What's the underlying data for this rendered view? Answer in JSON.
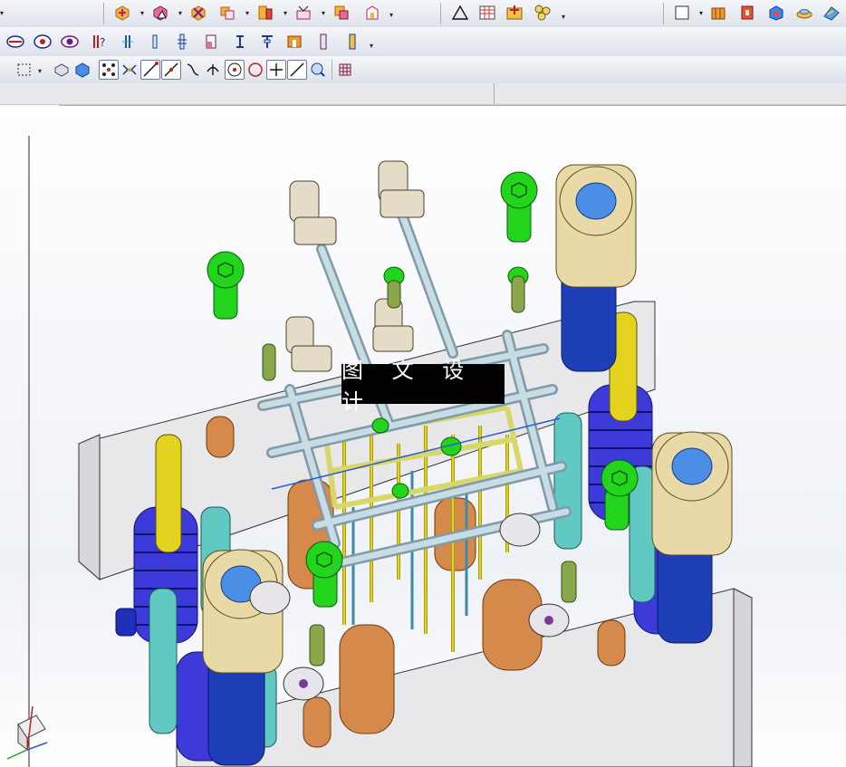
{
  "watermark": {
    "text": "图 文 设 计"
  },
  "toolbars": {
    "row1": [
      "move-component-icon",
      "assembly-constraint-icon",
      "replace-component-icon",
      "mirror-assembly-icon",
      "wave-geometry-icon",
      "exploded-view-icon",
      "clearance-analysis-icon",
      "part-navigator-icon",
      "triangle-sketch-icon",
      "spreadsheet-icon",
      "add-point-icon",
      "sequence-icon",
      "blank-sheet-icon",
      "extrude-icon",
      "feature-icon",
      "block-icon",
      "cone-icon",
      "render-icon"
    ],
    "row2": [
      "section-view-icon",
      "target-view-icon",
      "eye-view-icon",
      "information-icon",
      "datum-plane-icon",
      "pin-icon",
      "ejector-icon",
      "slide-icon",
      "lifter-icon",
      "sprue-icon",
      "gate-icon",
      "runner-icon",
      "cooling-icon"
    ],
    "row3": [
      "select-box-icon",
      "shaded-icon",
      "wireframe-icon",
      "snap-point-icon",
      "snap-grid-icon",
      "line-icon",
      "arc-icon",
      "curve-icon",
      "intersection-icon",
      "center-icon",
      "quadrant-icon",
      "plus-icon",
      "tangent-icon",
      "zoom-icon",
      "grid-icon"
    ]
  },
  "colors": {
    "mold_plate": "#e8e8ea",
    "spring": "#3c3ad8",
    "guide_bushing": "#e9d9a6",
    "guide_pillar": "#1f3fb8",
    "yellow_pin": "#e3d31f",
    "green_screw": "#22d41c",
    "orange_part": "#d5894a",
    "cooling_tube": "#a8c6d6",
    "cyan_part": "#62c9c2"
  }
}
